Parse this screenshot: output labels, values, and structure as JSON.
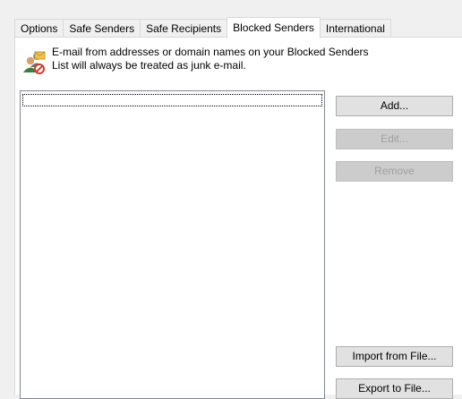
{
  "tabs": [
    {
      "label": "Options"
    },
    {
      "label": "Safe Senders"
    },
    {
      "label": "Safe Recipients"
    },
    {
      "label": "Blocked Senders",
      "active": true
    },
    {
      "label": "International"
    }
  ],
  "description": {
    "line1": "E-mail from addresses or domain names on your Blocked Senders",
    "line2": "List will always be treated as junk e-mail."
  },
  "list": {
    "items": []
  },
  "buttons": {
    "add": "Add...",
    "edit": "Edit...",
    "remove": "Remove",
    "import": "Import from File...",
    "export": "Export to File..."
  },
  "icons": {
    "info": "blocked-contacts-icon"
  }
}
